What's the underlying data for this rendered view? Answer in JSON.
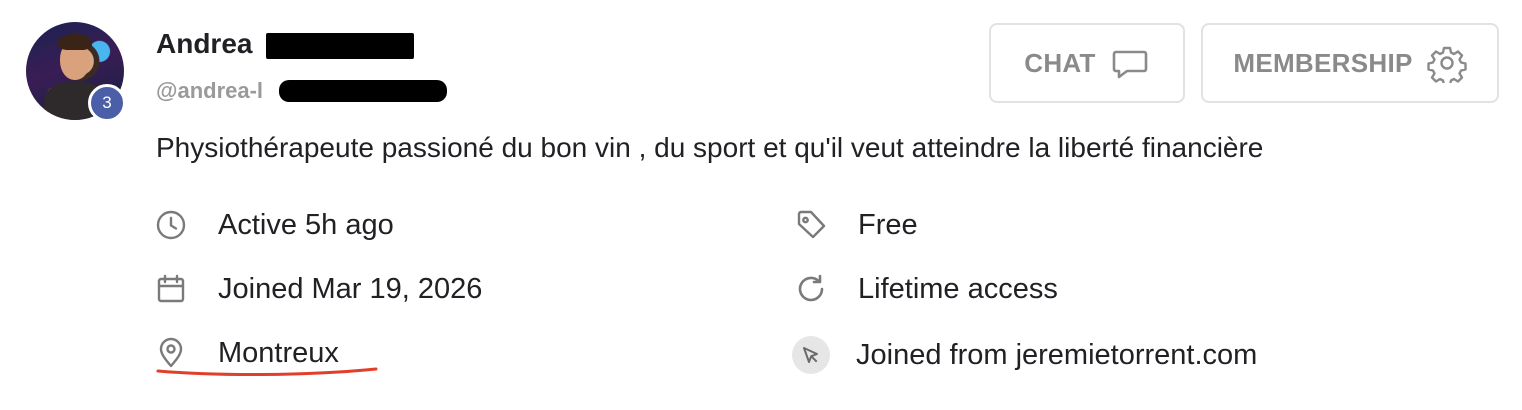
{
  "profile": {
    "name": "Andrea",
    "handle": "@andrea-l",
    "level": "3",
    "bio": "Physiothérapeute passioné du bon vin , du sport et qu'il veut atteindre la liberté financière"
  },
  "actions": {
    "chat_label": "CHAT",
    "membership_label": "MEMBERSHIP"
  },
  "details_left": [
    {
      "icon": "clock-icon",
      "text": "Active 5h ago"
    },
    {
      "icon": "calendar-icon",
      "text": "Joined Mar 19, 2026"
    },
    {
      "icon": "location-pin-icon",
      "text": "Montreux"
    }
  ],
  "details_right": [
    {
      "icon": "tag-icon",
      "text": "Free"
    },
    {
      "icon": "refresh-icon",
      "text": "Lifetime access"
    },
    {
      "icon": "cursor-icon",
      "text": "Joined from jeremietorrent.com"
    }
  ],
  "colors": {
    "badge": "#4b5ea8",
    "annotation_underline": "#e0402a",
    "muted_text": "#8a8a8a"
  }
}
